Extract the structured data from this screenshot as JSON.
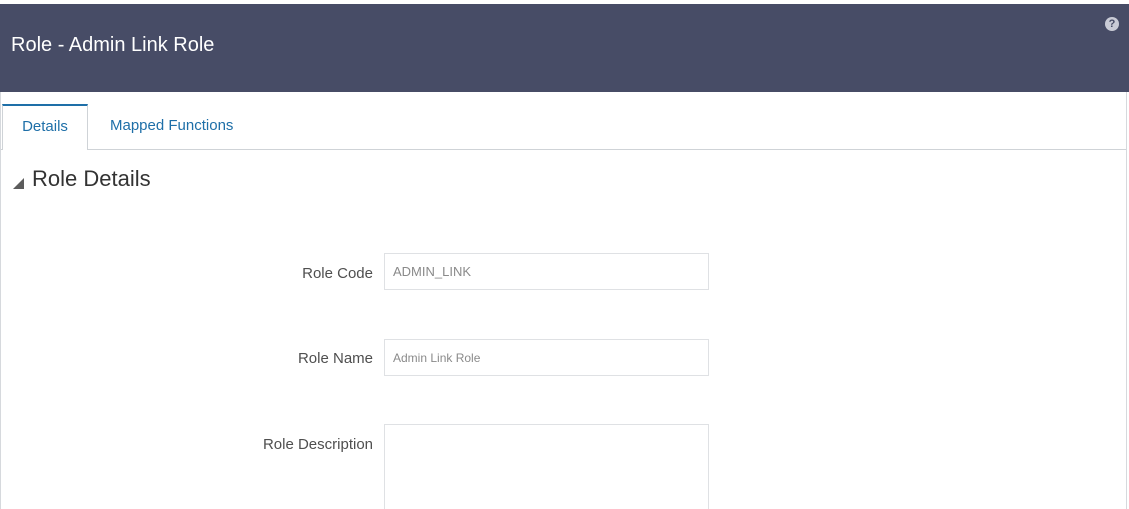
{
  "header": {
    "title": "Role - Admin Link Role",
    "help_symbol": "?"
  },
  "tabs": [
    {
      "label": "Details",
      "active": true
    },
    {
      "label": "Mapped Functions",
      "active": false
    }
  ],
  "section": {
    "title": "Role Details"
  },
  "form": {
    "role_code": {
      "label": "Role Code",
      "value": "ADMIN_LINK"
    },
    "role_name": {
      "label": "Role Name",
      "value": "Admin Link Role"
    },
    "role_description": {
      "label": "Role Description",
      "value": ""
    }
  },
  "colors": {
    "header_bg": "#474c66",
    "tab_accent": "#1e6fa8",
    "label_text": "#4f4f4f",
    "field_text": "#8a8a8a"
  },
  "icons": {
    "help": "help-icon",
    "collapse": "collapse-triangle-icon"
  }
}
